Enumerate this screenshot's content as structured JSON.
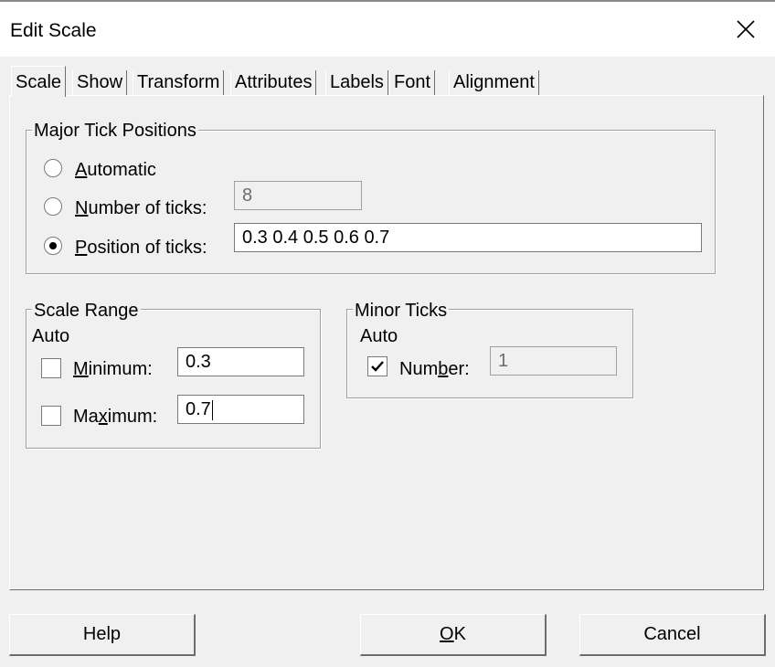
{
  "window": {
    "title": "Edit Scale"
  },
  "tabs": [
    {
      "label": "Scale",
      "active": true
    },
    {
      "label": "Show"
    },
    {
      "label": "Transform"
    },
    {
      "label": "Attributes"
    },
    {
      "label": "Labels"
    },
    {
      "label": "Font"
    },
    {
      "label": "Alignment"
    }
  ],
  "major_ticks": {
    "group_label": "Major Tick Positions",
    "automatic": {
      "mn": "A",
      "rest": "utomatic"
    },
    "number": {
      "mn": "N",
      "rest": "umber of ticks:",
      "value": "8"
    },
    "position": {
      "mn": "P",
      "rest": "osition of ticks:",
      "value": "0.3 0.4 0.5 0.6 0.7"
    },
    "selected": "position"
  },
  "scale_range": {
    "group_label": "Scale Range",
    "auto_label": "Auto",
    "minimum": {
      "pre": "",
      "mn": "M",
      "rest": "inimum:",
      "value": "0.3",
      "checked": false
    },
    "maximum": {
      "pre": "Ma",
      "mn": "x",
      "rest": "imum:",
      "value": "0.7",
      "checked": false
    }
  },
  "minor_ticks": {
    "group_label": "Minor Ticks",
    "auto_label": "Auto",
    "number": {
      "pre": "Num",
      "mn": "b",
      "rest": "er:",
      "value": "1",
      "checked": true
    }
  },
  "buttons": {
    "help": "Help",
    "ok": {
      "mn": "O",
      "rest": "K"
    },
    "cancel": "Cancel"
  }
}
